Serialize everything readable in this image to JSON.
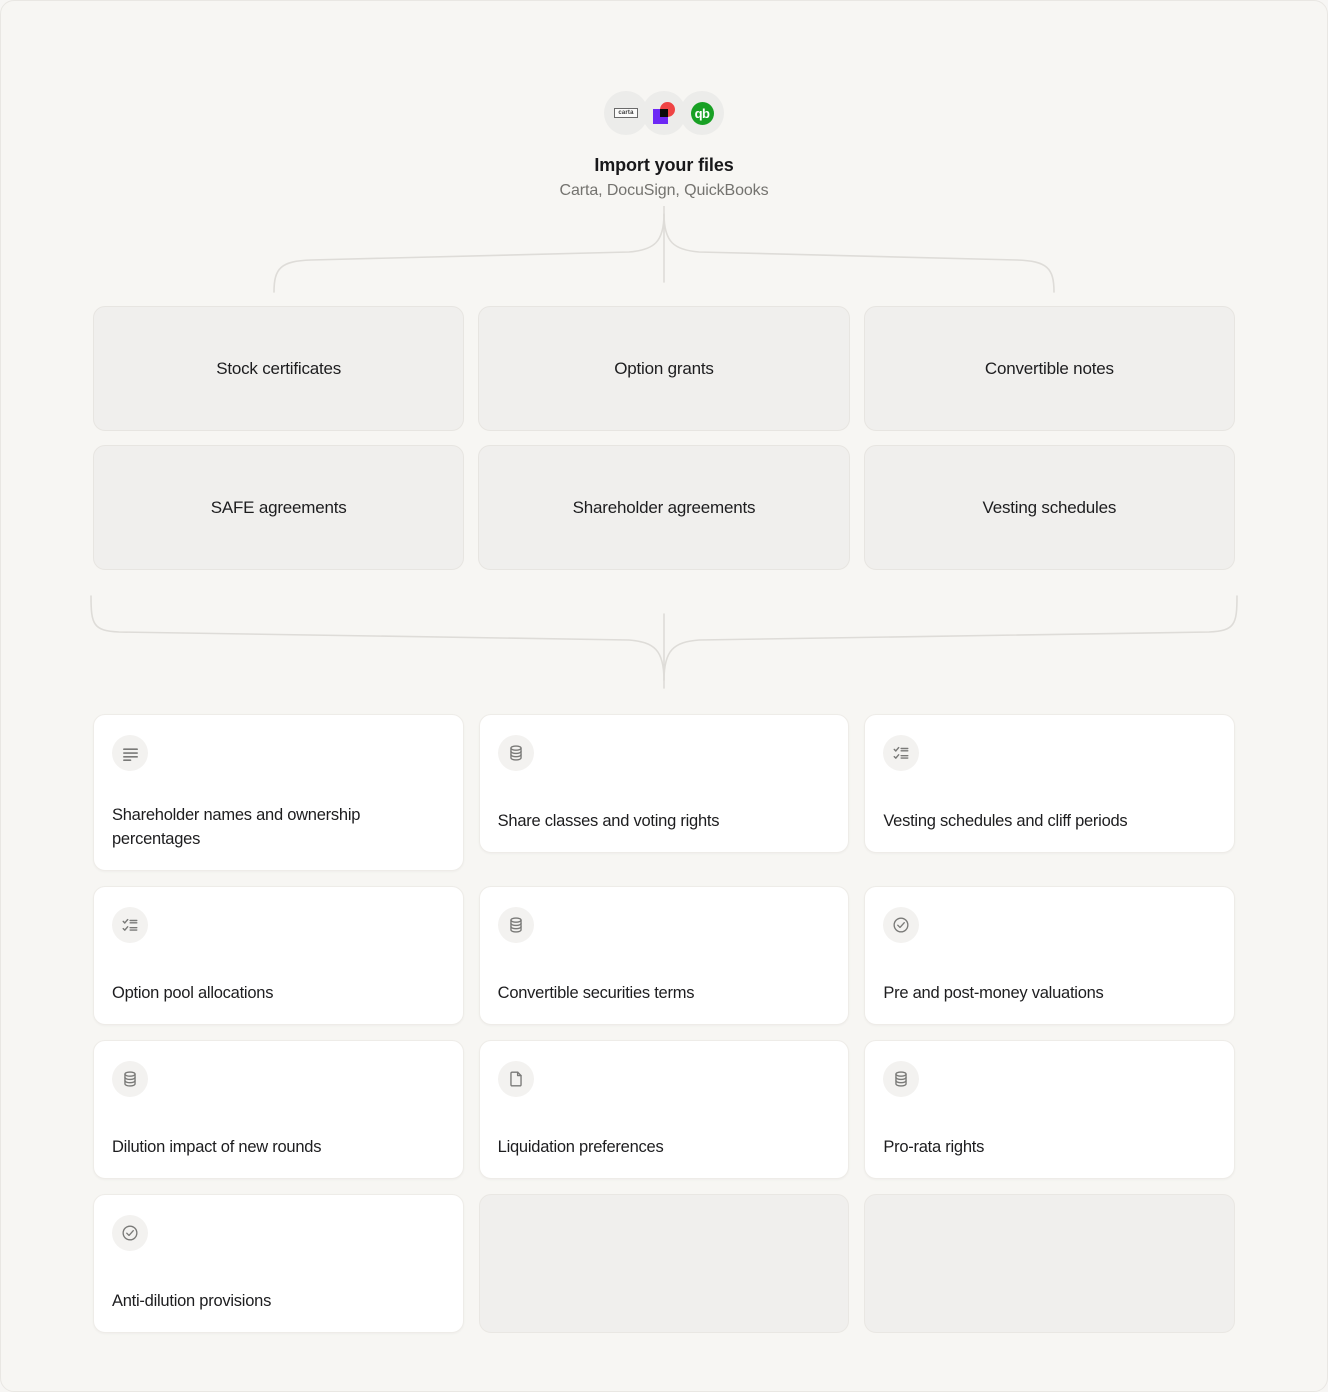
{
  "import": {
    "title": "Import your files",
    "subtitle": "Carta, DocuSign, QuickBooks",
    "logos": [
      {
        "name": "carta-logo",
        "mark": "carta"
      },
      {
        "name": "docusign-logo",
        "mark": ""
      },
      {
        "name": "quickbooks-logo",
        "mark": "qb"
      }
    ]
  },
  "source_types": [
    {
      "label": "Stock certificates"
    },
    {
      "label": "Option grants"
    },
    {
      "label": "Convertible notes"
    },
    {
      "label": "SAFE agreements"
    },
    {
      "label": "Shareholder agreements"
    },
    {
      "label": "Vesting schedules"
    }
  ],
  "outputs": [
    {
      "label": "Shareholder names and ownership percentages",
      "icon": "text-lines-icon"
    },
    {
      "label": "Share classes and voting rights",
      "icon": "database-icon"
    },
    {
      "label": "Vesting schedules and cliff periods",
      "icon": "checklist-icon"
    },
    {
      "label": "Option pool allocations",
      "icon": "checklist-icon"
    },
    {
      "label": "Convertible securities terms",
      "icon": "database-icon"
    },
    {
      "label": "Pre and post-money valuations",
      "icon": "check-circle-icon"
    },
    {
      "label": "Dilution impact of new rounds",
      "icon": "database-icon"
    },
    {
      "label": "Liquidation preferences",
      "icon": "file-icon"
    },
    {
      "label": "Pro-rata rights",
      "icon": "database-icon"
    },
    {
      "label": "Anti-dilution provisions",
      "icon": "check-circle-icon"
    }
  ],
  "empty_slots": 2,
  "colors": {
    "background": "#f7f6f3",
    "card": "#ffffff",
    "muted_box": "#f0efed",
    "connector": "#dedcd8",
    "text": "#1d1d1f",
    "subtext": "#74736f",
    "docusign_red": "#ef4444",
    "docusign_purple": "#6d28f5",
    "quickbooks_green": "#18a024"
  }
}
